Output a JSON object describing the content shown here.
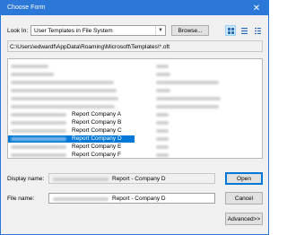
{
  "window": {
    "title": "Choose Form",
    "close_glyph": "✕"
  },
  "toolbar": {
    "lookin_label": "Look In:",
    "lookin_value": "User Templates in File System",
    "browse_label": "Browse...",
    "view_icons": [
      "large-icons-view-icon",
      "list-view-icon",
      "details-view-icon"
    ]
  },
  "path": "C:\\Users\\edwardf\\AppData\\Roaming\\Microsoft\\Templates\\*.oft",
  "list": {
    "items": [
      {
        "name": ""
      },
      {
        "name": ""
      },
      {
        "name": ""
      },
      {
        "name": ""
      },
      {
        "name": ""
      },
      {
        "name": ""
      },
      {
        "name": "Report Company A"
      },
      {
        "name": "Report Company B"
      },
      {
        "name": "Report Company C"
      },
      {
        "name": "Report Company D",
        "selected": true
      },
      {
        "name": "Report Company E"
      },
      {
        "name": "Report Company F"
      }
    ]
  },
  "display_name": {
    "label": "Display name:",
    "value": "Report - Company D"
  },
  "file_name": {
    "label": "File name:",
    "value": "Report - Company D"
  },
  "buttons": {
    "open": "Open",
    "cancel": "Cancel",
    "advanced": "Advanced>>"
  },
  "colors": {
    "accent": "#2b78d8",
    "selection": "#0078d7"
  }
}
